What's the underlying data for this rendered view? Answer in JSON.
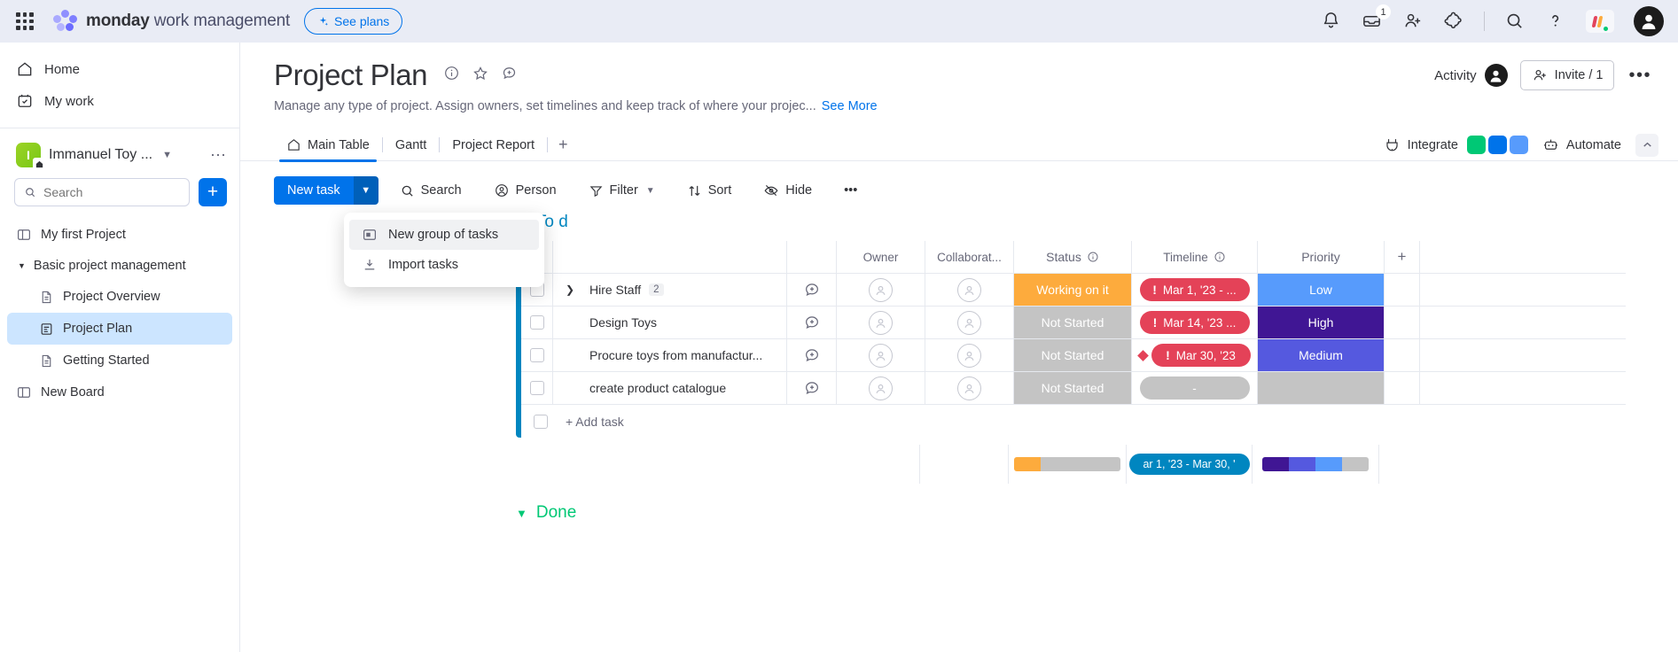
{
  "topbar": {
    "brand_bold": "monday",
    "brand_light": " work management",
    "see_plans": "See plans",
    "icons": {
      "apps_grid": "apps-grid-icon",
      "bell": "notifications-icon",
      "inbox": "inbox-icon",
      "inbox_badge": "1",
      "invite": "invite-member-icon",
      "apps": "apps-puzzle-icon",
      "search": "search-icon",
      "help": "help-icon",
      "monday_chip": "monday-logo-icon",
      "avatar": "user-avatar"
    }
  },
  "sidebar": {
    "top_items": [
      {
        "label": "Home",
        "icon": "home-icon"
      },
      {
        "label": "My work",
        "icon": "my-work-calendar-icon"
      }
    ],
    "workspace": {
      "initial": "I",
      "name": "Immanuel Toy ...",
      "caret": "chevron-down-icon",
      "more": "more-options-icon"
    },
    "search": {
      "placeholder": "Search",
      "value": ""
    },
    "add_button": "+",
    "nav": [
      {
        "label": "My first Project",
        "icon": "board-icon",
        "type": "board",
        "active": false
      },
      {
        "label": "Basic project management",
        "icon": "folder-triangle-icon",
        "type": "group",
        "active": false
      },
      {
        "label": "Project Overview",
        "icon": "doc-icon",
        "type": "child",
        "active": false
      },
      {
        "label": "Project Plan",
        "icon": "table-doc-icon",
        "type": "child",
        "active": true
      },
      {
        "label": "Getting Started",
        "icon": "doc-icon",
        "type": "child",
        "active": false
      },
      {
        "label": "New Board",
        "icon": "board-icon",
        "type": "board",
        "active": false
      }
    ]
  },
  "board": {
    "title": "Project Plan",
    "title_icons": [
      "info-icon",
      "star-icon",
      "add-comment-icon"
    ],
    "description": "Manage any type of project. Assign owners, set timelines and keep track of where your projec...",
    "see_more": "See More",
    "activity_label": "Activity",
    "invite_label": "Invite / 1",
    "more_label": "•••"
  },
  "tabs": [
    {
      "label": "Main Table",
      "icon": "home-icon",
      "active": true
    },
    {
      "label": "Gantt",
      "icon": "",
      "active": false
    },
    {
      "label": "Project Report",
      "icon": "",
      "active": false
    }
  ],
  "tabs_add": "+",
  "tabs_right": {
    "integrate": "Integrate",
    "automate": "Automate",
    "integrate_icon": "integrate-icon",
    "automate_icon": "automate-robot-icon",
    "collapse_icon": "chevron-up-icon",
    "int_colors": [
      "#00c875",
      "#0073ea",
      "#579bfc"
    ]
  },
  "toolbar": {
    "new_task": "New task",
    "new_task_caret": "chevron-down-icon",
    "buttons": [
      {
        "label": "Search",
        "icon": "search-icon"
      },
      {
        "label": "Person",
        "icon": "person-icon"
      },
      {
        "label": "Filter",
        "icon": "filter-icon",
        "caret": true
      },
      {
        "label": "Sort",
        "icon": "sort-icon"
      },
      {
        "label": "Hide",
        "icon": "hide-eye-icon"
      }
    ],
    "more": "•••"
  },
  "dropdown_menu": {
    "items": [
      {
        "label": "New group of tasks",
        "icon": "group-icon",
        "hovered": true
      },
      {
        "label": "Import tasks",
        "icon": "import-download-icon",
        "hovered": false
      }
    ]
  },
  "group": {
    "name": "To d",
    "caret": "chevron-down-icon",
    "color": "#0086c0"
  },
  "table": {
    "columns": [
      {
        "label": "",
        "key": "check"
      },
      {
        "label": "",
        "key": "name"
      },
      {
        "label": "",
        "key": "chat"
      },
      {
        "label": "Owner",
        "key": "owner",
        "info": false
      },
      {
        "label": "Collaborat...",
        "key": "collab",
        "info": false
      },
      {
        "label": "Status",
        "key": "status",
        "info": true
      },
      {
        "label": "Timeline",
        "key": "timeline",
        "info": true
      },
      {
        "label": "Priority",
        "key": "priority",
        "info": false
      }
    ],
    "add_column": "+",
    "rows": [
      {
        "name": "Hire Staff",
        "subtask_count": "2",
        "expandable": true,
        "status": "Working on it",
        "status_color": "#fdab3d",
        "timeline": "Mar 1, '23 - ...",
        "timeline_style": "red",
        "timeline_milestone": false,
        "priority": "Low",
        "priority_color": "#579bfc"
      },
      {
        "name": "Design Toys",
        "subtask_count": "",
        "expandable": false,
        "status": "Not Started",
        "status_color": "#c4c4c4",
        "timeline": "Mar 14, '23 ...",
        "timeline_style": "red",
        "timeline_milestone": false,
        "priority": "High",
        "priority_color": "#401694"
      },
      {
        "name": "Procure toys from manufactur...",
        "subtask_count": "",
        "expandable": false,
        "status": "Not Started",
        "status_color": "#c4c4c4",
        "timeline": "Mar 30, '23",
        "timeline_style": "red",
        "timeline_milestone": true,
        "priority": "Medium",
        "priority_color": "#5559df"
      },
      {
        "name": "create product catalogue",
        "subtask_count": "",
        "expandable": false,
        "status": "Not Started",
        "status_color": "#c4c4c4",
        "timeline": "-",
        "timeline_style": "gray",
        "timeline_milestone": false,
        "priority": "",
        "priority_color": "#c4c4c4"
      }
    ],
    "add_task": "+ Add task"
  },
  "summary": {
    "status_segments": [
      {
        "color": "#fdab3d",
        "pct": 25
      },
      {
        "color": "#c4c4c4",
        "pct": 75
      }
    ],
    "timeline_label": "ar 1, '23 - Mar 30, '",
    "priority_segments": [
      {
        "color": "#401694",
        "pct": 25
      },
      {
        "color": "#5559df",
        "pct": 25
      },
      {
        "color": "#579bfc",
        "pct": 25
      },
      {
        "color": "#c4c4c4",
        "pct": 25
      }
    ]
  },
  "done_group": {
    "name": "Done",
    "caret": "chevron-down-icon",
    "color": "#00c875"
  }
}
